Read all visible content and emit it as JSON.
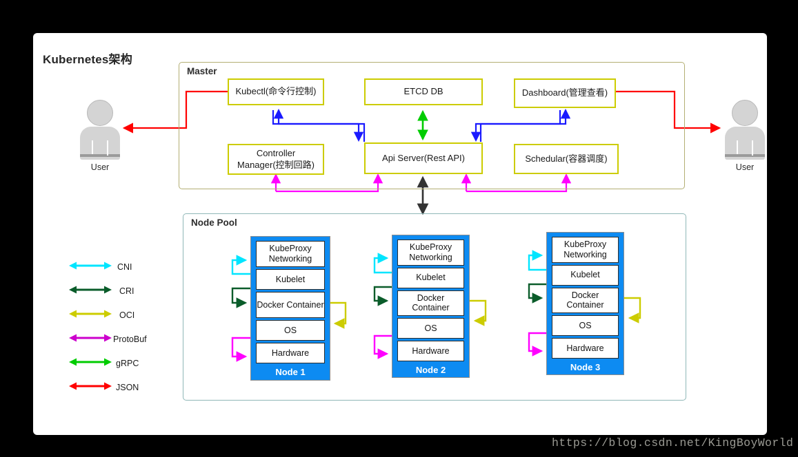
{
  "page": {
    "title": "Kubernetes架构",
    "watermark": "https://blog.csdn.net/KingBoyWorld",
    "background_color": "#000000",
    "card_color": "#ffffff"
  },
  "users": {
    "left": {
      "label": "User",
      "name": "user-left"
    },
    "right": {
      "label": "User",
      "name": "user-right"
    }
  },
  "master": {
    "label": "Master",
    "border_color": "#b3ae73",
    "box_border_color": "#cccc00",
    "components": [
      {
        "id": "kubectl",
        "label": "Kubectl(命令行控制)"
      },
      {
        "id": "etcd",
        "label": "ETCD DB"
      },
      {
        "id": "dashboard",
        "label": "Dashboard(管理查看)"
      },
      {
        "id": "controller-manager",
        "label": "Controller Manager(控制回路)"
      },
      {
        "id": "api-server",
        "label": "Api Server(Rest API)"
      },
      {
        "id": "schedular",
        "label": "Schedular(容器调度)"
      }
    ]
  },
  "node_pool": {
    "label": "Node Pool",
    "border_color": "#8fb7b7",
    "node_fill": "#0d8bf2",
    "layer_names": [
      "KubeProxy Networking",
      "Kubelet",
      "Docker Container",
      "OS",
      "Hardware"
    ],
    "nodes": [
      {
        "name": "Node 1",
        "layers": [
          "KubeProxy Networking",
          "Kubelet",
          "Docker Container",
          "OS",
          "Hardware"
        ]
      },
      {
        "name": "Node 2",
        "layers": [
          "KubeProxy Networking",
          "Kubelet",
          "Docker Container",
          "OS",
          "Hardware"
        ]
      },
      {
        "name": "Node 3",
        "layers": [
          "KubeProxy Networking",
          "Kubelet",
          "Docker Container",
          "OS",
          "Hardware"
        ]
      }
    ]
  },
  "legend": {
    "items": [
      {
        "label": "CNI",
        "color": "#00e5ff"
      },
      {
        "label": "CRI",
        "color": "#0a5c2a"
      },
      {
        "label": "OCI",
        "color": "#cccc00"
      },
      {
        "label": "ProtoBuf",
        "color": "#cc00cc"
      },
      {
        "label": "gRPC",
        "color": "#00cc00"
      },
      {
        "label": "JSON",
        "color": "#ff0000"
      }
    ]
  },
  "connections": {
    "json_color": "#ff0000",
    "protobuf_color": "#ff00ff",
    "grpc_color": "#00cc00",
    "blue_color": "#1a1aff",
    "black_color": "#333333",
    "cni_color": "#00e5ff",
    "cri_color": "#0a5c2a",
    "oci_color": "#cccc00"
  }
}
